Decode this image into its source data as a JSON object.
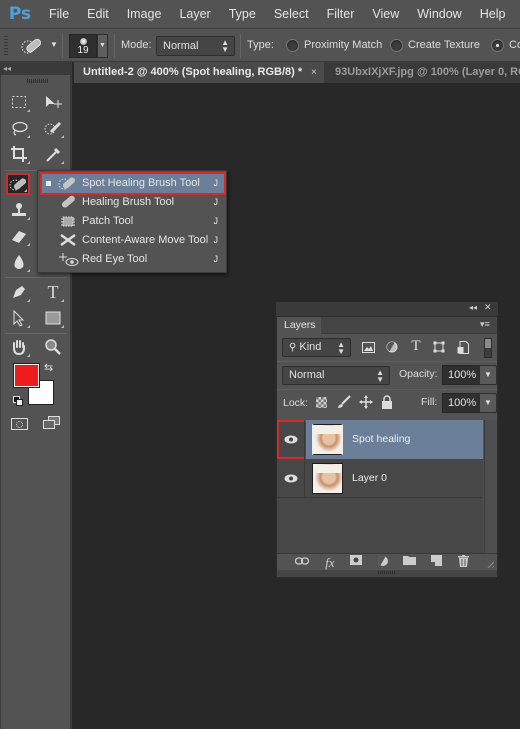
{
  "app": {
    "logo": "Ps",
    "menu": [
      "File",
      "Edit",
      "Image",
      "Layer",
      "Type",
      "Select",
      "Filter",
      "View",
      "Window",
      "Help"
    ]
  },
  "options_bar": {
    "tool_icon": "spot-healing-brush-icon",
    "brush_size": "19",
    "mode_label": "Mode:",
    "mode_value": "Normal",
    "type_label": "Type:",
    "type_options": [
      {
        "label": "Proximity Match",
        "selected": false
      },
      {
        "label": "Create Texture",
        "selected": false
      },
      {
        "label": "Co",
        "selected": true
      }
    ]
  },
  "doc_tabs": [
    {
      "label": "Untitled-2 @ 400% (Spot healing, RGB/8) *",
      "active": true,
      "close": "×"
    },
    {
      "label": "93UbxIXjXF.jpg @ 100% (Layer 0, RG",
      "active": false
    }
  ],
  "toolbox": {
    "collapse": "◂◂",
    "tools": [
      {
        "name": "rectangular-marquee",
        "glyph": "⬚"
      },
      {
        "name": "move",
        "glyph": "▸✥"
      },
      {
        "name": "lasso",
        "glyph": "ℓ"
      },
      {
        "name": "quick-selection",
        "glyph": "⁘"
      },
      {
        "name": "crop",
        "glyph": "⌗"
      },
      {
        "name": "eyedropper",
        "glyph": "⟋"
      },
      {
        "name": "spot-healing-brush",
        "glyph": "✎",
        "selected": true
      },
      {
        "name": "brush",
        "glyph": "✎"
      },
      {
        "name": "clone-stamp",
        "glyph": "⊥"
      },
      {
        "name": "history-brush",
        "glyph": "↶"
      },
      {
        "name": "eraser",
        "glyph": "▱"
      },
      {
        "name": "gradient",
        "glyph": "▭"
      },
      {
        "name": "blur",
        "glyph": "●"
      },
      {
        "name": "dodge",
        "glyph": "◐"
      },
      {
        "name": "pen",
        "glyph": "✒"
      },
      {
        "name": "type",
        "glyph": "T"
      },
      {
        "name": "path-selection",
        "glyph": "↖"
      },
      {
        "name": "rectangle",
        "glyph": "■"
      },
      {
        "name": "hand",
        "glyph": "✋"
      },
      {
        "name": "zoom",
        "glyph": "⚲"
      }
    ],
    "foreground_color": "#ee1c1c",
    "background_color": "#ffffff",
    "swap_glyph": "⇆",
    "quick_mask_glyph": "◌",
    "screen_mode_glyph": "⧉"
  },
  "tool_flyout": {
    "items": [
      {
        "label": "Spot Healing Brush Tool",
        "shortcut": "J",
        "icon": "spot-healing-brush-icon",
        "glyph": "✎",
        "selected": true
      },
      {
        "label": "Healing Brush Tool",
        "shortcut": "J",
        "icon": "healing-brush-icon",
        "glyph": "✎",
        "selected": false
      },
      {
        "label": "Patch Tool",
        "shortcut": "J",
        "icon": "patch-icon",
        "glyph": "⧈",
        "selected": false
      },
      {
        "label": "Content-Aware Move Tool",
        "shortcut": "J",
        "icon": "content-aware-move-icon",
        "glyph": "⤨",
        "selected": false
      },
      {
        "label": "Red Eye Tool",
        "shortcut": "J",
        "icon": "red-eye-icon",
        "glyph": "+◉",
        "selected": false
      }
    ]
  },
  "layers_panel": {
    "title": "Layers",
    "panel_controls": {
      "collapse": "◂◂",
      "close": "✕",
      "menu": "▾≡"
    },
    "filter_kind": "Kind",
    "blend_mode": "Normal",
    "opacity_label": "Opacity:",
    "opacity_value": "100%",
    "lock_label": "Lock:",
    "fill_label": "Fill:",
    "fill_value": "100%",
    "layers": [
      {
        "name": "Spot healing",
        "visible": true,
        "selected": true
      },
      {
        "name": "Layer 0",
        "visible": true,
        "selected": false
      }
    ],
    "footer_icons": [
      "link-layers-icon",
      "fx-icon",
      "add-mask-icon",
      "adjustment-layer-icon",
      "new-group-icon",
      "new-layer-icon",
      "delete-layer-icon"
    ],
    "fx_label": "fx"
  },
  "colors": {
    "highlight_red": "#d42a2a",
    "selection_blue": "#6b7f99",
    "ps_blue": "#4f9fd8"
  }
}
